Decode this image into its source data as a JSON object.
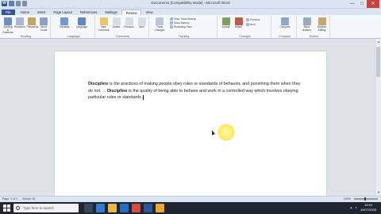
{
  "window": {
    "title": "Document1 [Compatibility Mode] - Microsoft Word",
    "minimize": "—",
    "maximize": "□",
    "close": "✕"
  },
  "tabs": [
    "File",
    "Home",
    "Insert",
    "Page Layout",
    "References",
    "Mailings",
    "Review",
    "View"
  ],
  "active_tab": "Review",
  "ribbon": {
    "groups": [
      {
        "label": "Proofing",
        "buttons": [
          "Spelling & Grammar",
          "Research",
          "Thesaurus",
          "Word Count"
        ]
      },
      {
        "label": "Language",
        "buttons": [
          "Translate",
          "Language"
        ]
      },
      {
        "label": "Comments",
        "buttons": [
          "New Comment",
          "Delete",
          "Previous",
          "Next"
        ]
      },
      {
        "label": "Tracking",
        "buttons": [
          "Track Changes",
          "Final: Show Markup",
          "Show Markup",
          "Reviewing Pane"
        ]
      },
      {
        "label": "Changes",
        "buttons": [
          "Accept",
          "Reject",
          "Previous",
          "Next"
        ]
      },
      {
        "label": "Compare",
        "buttons": [
          "Compare"
        ]
      },
      {
        "label": "Protect",
        "buttons": [
          "Block Authors",
          "Restrict Editing"
        ]
      }
    ]
  },
  "document": {
    "p1_bold": "Discipline",
    "p1_rest": " is the practices of making people obey rules or standards of behavior, and punishing them when they do not. ... ",
    "p2_bold": "Discipline",
    "p2_rest": " is the quality of being able to behave and work in a controlled way which involves obeying particular rules or standards."
  },
  "statusbar": {
    "page": "Page: 1 of 1",
    "words": "Words: 51",
    "zoom": "100%"
  },
  "taskbar": {
    "search_placeholder": "Type here to search",
    "time": "19:54",
    "date": "10/07/2020"
  }
}
